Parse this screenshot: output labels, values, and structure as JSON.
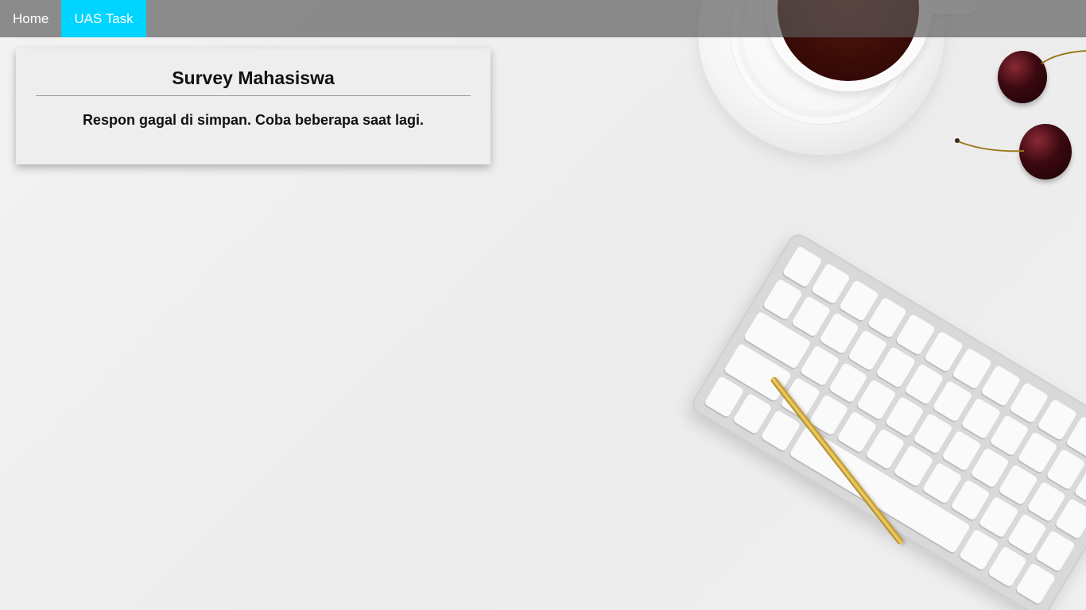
{
  "navbar": {
    "items": [
      {
        "label": "Home",
        "active": false
      },
      {
        "label": "UAS Task",
        "active": true
      }
    ],
    "active_color": "#00d4ff"
  },
  "card": {
    "title": "Survey Mahasiswa",
    "message": "Respon gagal di simpan. Coba beberapa saat lagi."
  },
  "background": {
    "description_icons": [
      "coffee-cup-icon",
      "cherry-icon",
      "keyboard-icon",
      "pen-icon"
    ]
  }
}
